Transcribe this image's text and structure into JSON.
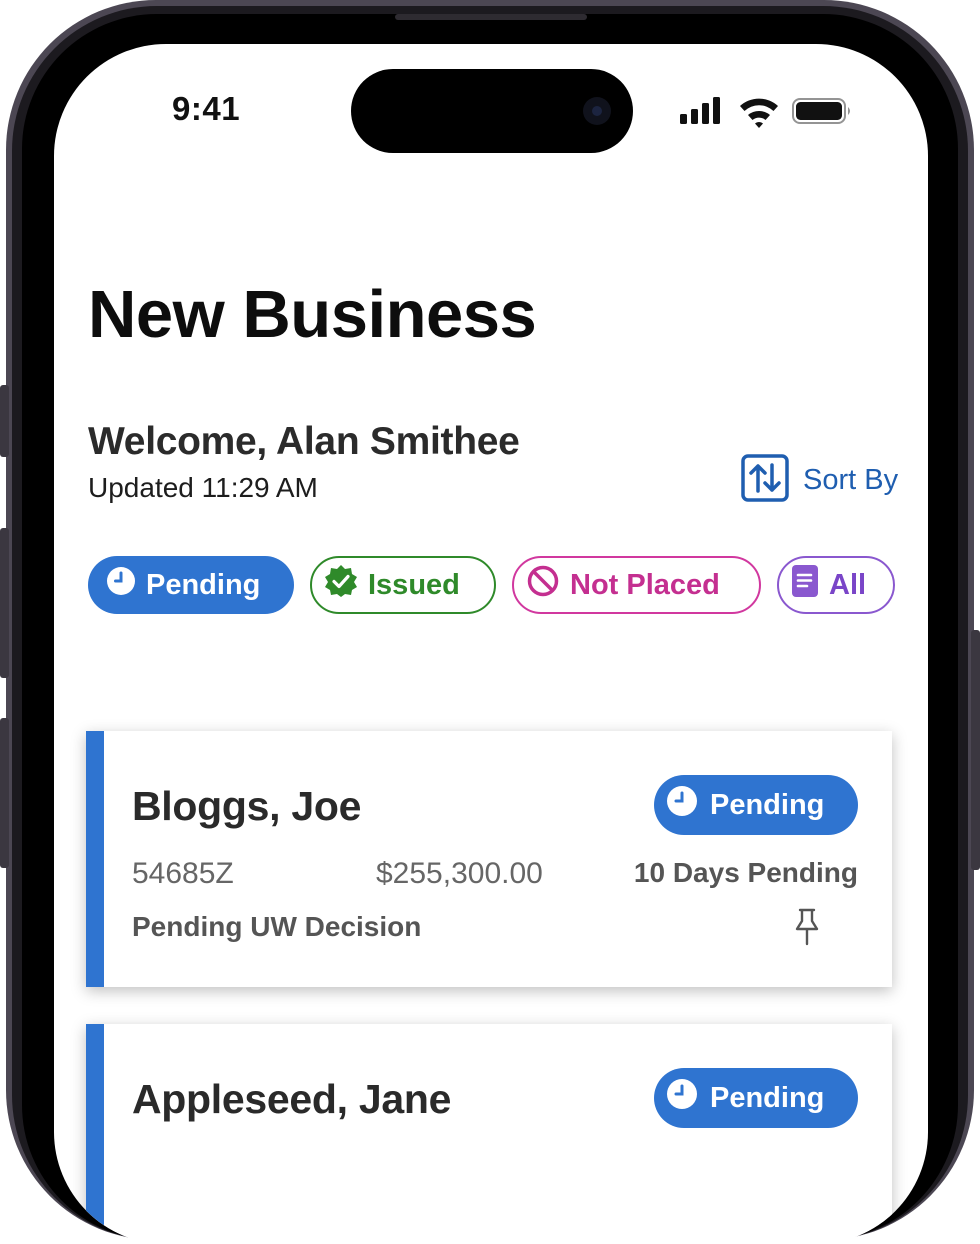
{
  "status_bar": {
    "time": "9:41"
  },
  "page": {
    "title": "New Business"
  },
  "header": {
    "welcome": "Welcome, Alan Smithee",
    "updated": "Updated 11:29 AM",
    "sort_label": "Sort By"
  },
  "filters": [
    {
      "label": "Pending",
      "icon": "clock-icon",
      "color": "#2f74d0",
      "selected": true
    },
    {
      "label": "Issued",
      "icon": "verified-check-icon",
      "color": "#2f8a2a",
      "selected": false
    },
    {
      "label": "Not Placed",
      "icon": "prohibited-icon",
      "color": "#d1389f",
      "selected": false
    },
    {
      "label": "All",
      "icon": "document-icon",
      "color": "#8a58cf",
      "selected": false
    }
  ],
  "cases": [
    {
      "name": "Bloggs, Joe",
      "status_badge": "Pending",
      "policy_number": "54685Z",
      "amount": "$255,300.00",
      "days_pending": "10 Days Pending",
      "status_detail": "Pending UW Decision",
      "pin_icon": "pin-icon"
    },
    {
      "name": "Appleseed, Jane",
      "status_badge": "Pending"
    }
  ],
  "colors": {
    "accent": "#2f74d0",
    "issued": "#2f8a2a",
    "not_placed": "#d1389f",
    "all": "#8a58cf"
  }
}
